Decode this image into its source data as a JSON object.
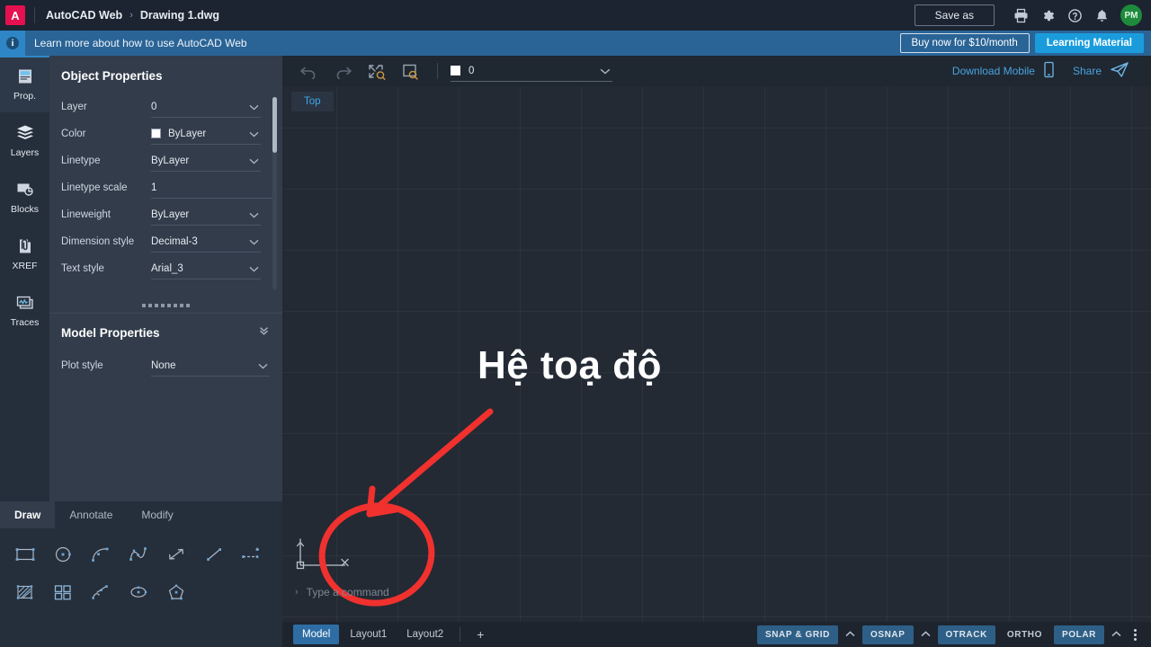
{
  "header": {
    "logo_text": "A",
    "app_name": "AutoCAD Web",
    "breadcrumb_sep": "›",
    "file_name": "Drawing 1.dwg",
    "save_as_label": "Save as",
    "icons": [
      "print-icon",
      "gear-icon",
      "help-icon",
      "bell-icon"
    ],
    "avatar_initials": "PM"
  },
  "banner": {
    "info_glyph": "i",
    "message": "Learn more about how to use AutoCAD Web",
    "buy_label": "Buy now for $10/month",
    "learning_label": "Learning Material"
  },
  "rail": {
    "items": [
      {
        "label": "Prop.",
        "icon": "properties-icon",
        "active": true
      },
      {
        "label": "Layers",
        "icon": "layers-icon",
        "active": false
      },
      {
        "label": "Blocks",
        "icon": "blocks-icon",
        "active": false
      },
      {
        "label": "XREF",
        "icon": "xref-icon",
        "active": false
      },
      {
        "label": "Traces",
        "icon": "traces-icon",
        "active": false
      }
    ]
  },
  "object_properties": {
    "title": "Object Properties",
    "rows": [
      {
        "label": "Layer",
        "value": "0",
        "type": "select",
        "swatch": null
      },
      {
        "label": "Color",
        "value": "ByLayer",
        "type": "select",
        "swatch": "#ffffff"
      },
      {
        "label": "Linetype",
        "value": "ByLayer",
        "type": "select",
        "swatch": null
      },
      {
        "label": "Linetype scale",
        "value": "1",
        "type": "text",
        "swatch": null
      },
      {
        "label": "Lineweight",
        "value": "ByLayer",
        "type": "select",
        "swatch": null
      },
      {
        "label": "Dimension style",
        "value": "Decimal-3",
        "type": "select",
        "swatch": null
      },
      {
        "label": "Text style",
        "value": "Arial_3",
        "type": "select",
        "swatch": null
      }
    ]
  },
  "model_properties": {
    "title": "Model Properties",
    "rows": [
      {
        "label": "Plot style",
        "value": "None",
        "type": "select"
      }
    ]
  },
  "draw_toolbar": {
    "tabs": [
      {
        "label": "Draw",
        "active": true
      },
      {
        "label": "Annotate",
        "active": false
      },
      {
        "label": "Modify",
        "active": false
      }
    ],
    "tools": [
      "rectangle-icon",
      "circle-icon",
      "arc-icon",
      "spline-icon",
      "ray-icon",
      "line-icon",
      "dimension-icon",
      "hatch-icon",
      "array-icon",
      "polyline-arc-icon",
      "ellipse-icon",
      "polygon-icon"
    ]
  },
  "canvas_toolbar": {
    "undo_icon": "undo-icon",
    "redo_icon": "redo-icon",
    "zoom_extents_icon": "zoom-extents-icon",
    "zoom_window_icon": "zoom-window-icon",
    "layer_value": "0",
    "layer_swatch": "#ffffff",
    "download_mobile_label": "Download Mobile",
    "share_label": "Share"
  },
  "viewport": {
    "view_label": "Top",
    "ucs_x_label": "X",
    "ucs_y_label": "Y"
  },
  "annotations": {
    "callout_text": "Hệ toạ độ",
    "marker_color": "#f0312e"
  },
  "command_line": {
    "prompt": "›",
    "placeholder": "Type a command",
    "value": ""
  },
  "status_bar": {
    "layout_tabs": [
      {
        "label": "Model",
        "active": true
      },
      {
        "label": "Layout1",
        "active": false
      },
      {
        "label": "Layout2",
        "active": false
      }
    ],
    "add_label": "+",
    "toggles": [
      {
        "label": "SNAP & GRID",
        "on": true,
        "has_chevron": true
      },
      {
        "label": "OSNAP",
        "on": true,
        "has_chevron": true
      },
      {
        "label": "OTRACK",
        "on": true,
        "has_chevron": false
      },
      {
        "label": "ORTHO",
        "on": false,
        "has_chevron": false
      },
      {
        "label": "POLAR",
        "on": true,
        "has_chevron": true
      }
    ]
  }
}
